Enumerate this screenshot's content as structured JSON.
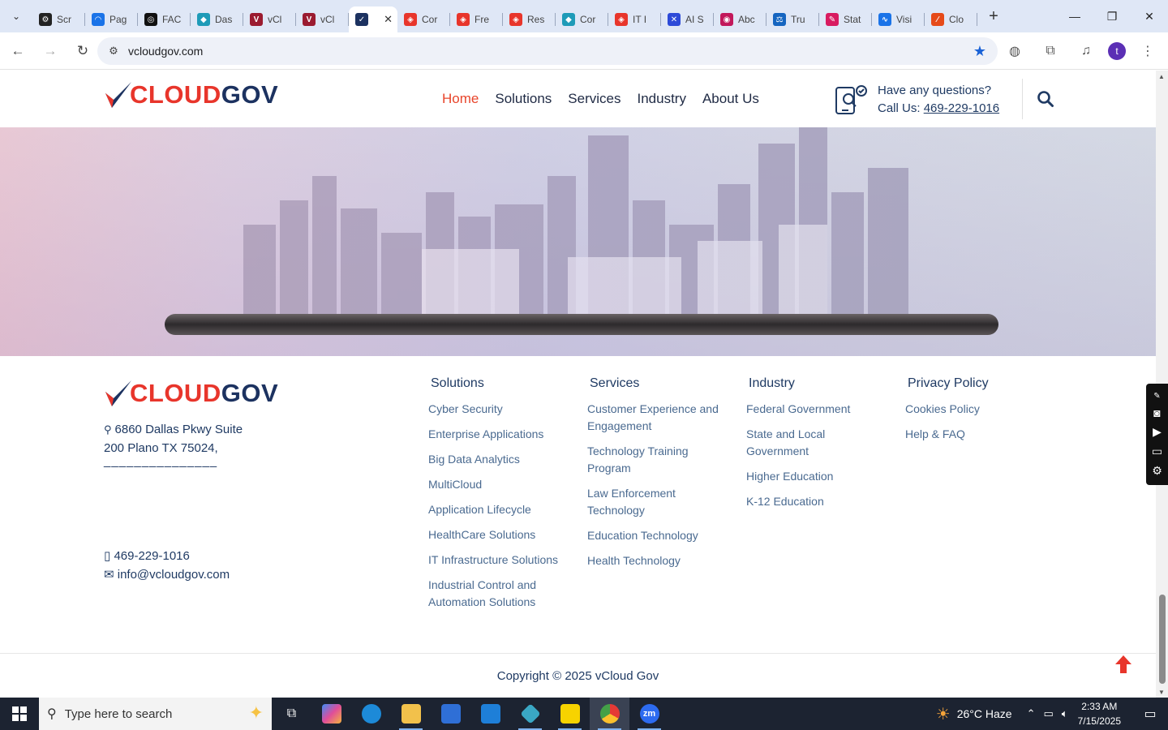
{
  "browser": {
    "tabs": [
      {
        "label": "Scr",
        "color": "#222222",
        "glyph": "⚙"
      },
      {
        "label": "Pag",
        "color": "#1a73e8",
        "glyph": "◠"
      },
      {
        "label": "FAC",
        "color": "#111111",
        "glyph": "◎"
      },
      {
        "label": "Das",
        "color": "#1e9bb8",
        "glyph": "◆"
      },
      {
        "label": "vCl",
        "color": "#9b1b30",
        "glyph": "V"
      },
      {
        "label": "vCl",
        "color": "#9b1b30",
        "glyph": "V"
      },
      {
        "label": "",
        "color": "#1c3260",
        "glyph": "✓",
        "active": true
      },
      {
        "label": "Cor",
        "color": "#e8352b",
        "glyph": "◈"
      },
      {
        "label": "Fre",
        "color": "#e8352b",
        "glyph": "◈"
      },
      {
        "label": "Res",
        "color": "#e8352b",
        "glyph": "◈"
      },
      {
        "label": "Cor",
        "color": "#1e9bb8",
        "glyph": "◆"
      },
      {
        "label": "IT I",
        "color": "#e8352b",
        "glyph": "◈"
      },
      {
        "label": "AI S",
        "color": "#2d4ad8",
        "glyph": "✕"
      },
      {
        "label": "Abc",
        "color": "#c2185b",
        "glyph": "◉"
      },
      {
        "label": "Tru",
        "color": "#1565c0",
        "glyph": "⚖"
      },
      {
        "label": "Stat",
        "color": "#d81b60",
        "glyph": "✎"
      },
      {
        "label": "Visi",
        "color": "#1a73e8",
        "glyph": "∿"
      },
      {
        "label": "Clo",
        "color": "#e64a19",
        "glyph": "∕"
      }
    ],
    "active_tab_close": "✕",
    "new_tab": "+",
    "url": "vcloudgov.com"
  },
  "site": {
    "logo": {
      "part1": "CLOUD",
      "part2": "GOV"
    },
    "nav": [
      {
        "label": "Home",
        "active": true
      },
      {
        "label": "Solutions"
      },
      {
        "label": "Services"
      },
      {
        "label": "Industry"
      },
      {
        "label": "About Us"
      }
    ],
    "contact": {
      "question": "Have any questions?",
      "call_prefix": "Call Us: ",
      "phone": "469-229-1016"
    }
  },
  "footer": {
    "address_line1": "6860 Dallas Pkwy Suite",
    "address_line2": "200 Plano TX 75024,",
    "separator": "_______________",
    "phone": "469-229-1016",
    "email": "info@vcloudgov.com",
    "columns": [
      {
        "title": "Solutions",
        "items": [
          "Cyber Security",
          "Enterprise Applications",
          "Big Data Analytics",
          "MultiCloud",
          "Application Lifecycle",
          "HealthCare Solutions",
          "IT Infrastructure Solutions",
          "Industrial Control and Automation Solutions"
        ]
      },
      {
        "title": "Services",
        "items": [
          "Customer Experience and Engagement",
          "Technology Training Program",
          "Law Enforcement Technology",
          "Education Technology",
          "Health Technology"
        ]
      },
      {
        "title": "Industry",
        "items": [
          "Federal Government",
          "State and Local Government",
          "Higher Education",
          "K-12 Education"
        ]
      },
      {
        "title": "Privacy Policy",
        "items": [
          "Cookies Policy",
          "Help & FAQ"
        ]
      }
    ],
    "copyright": "Copyright © 2025 vCloud Gov"
  },
  "taskbar": {
    "search_placeholder": "Type here to search",
    "weather": {
      "temp": "26°C",
      "condition": "Haze"
    },
    "time": "2:33 AM",
    "date": "7/15/2025"
  },
  "colors": {
    "accent_red": "#e8352b",
    "brand_navy": "#1c3260",
    "link_blue": "#4a6a90"
  }
}
